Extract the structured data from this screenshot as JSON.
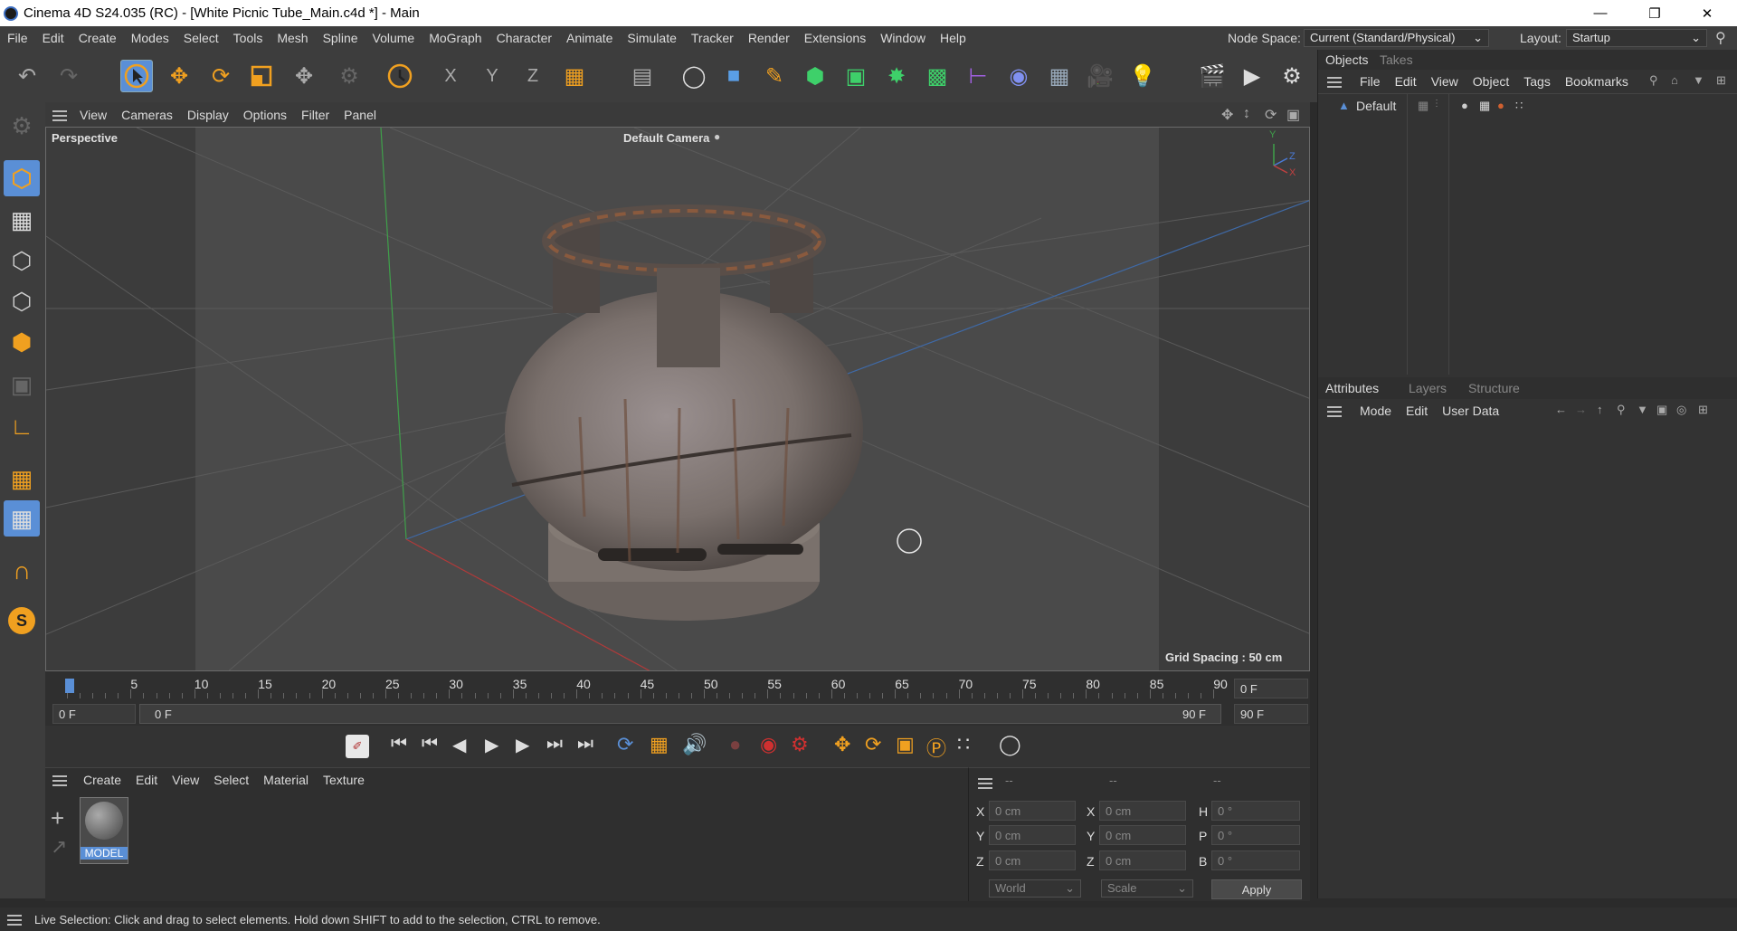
{
  "app": {
    "title": "Cinema 4D S24.035 (RC) - [White Picnic Tube_Main.c4d *] - Main"
  },
  "menubar": {
    "items": [
      "File",
      "Edit",
      "Create",
      "Modes",
      "Select",
      "Tools",
      "Mesh",
      "Spline",
      "Volume",
      "MoGraph",
      "Character",
      "Animate",
      "Simulate",
      "Tracker",
      "Render",
      "Extensions",
      "Window",
      "Help"
    ],
    "node_space_label": "Node Space:",
    "node_space_value": "Current (Standard/Physical)",
    "layout_label": "Layout:",
    "layout_value": "Startup"
  },
  "viewport": {
    "menu": [
      "View",
      "Cameras",
      "Display",
      "Options",
      "Filter",
      "Panel"
    ],
    "view_name": "Perspective",
    "camera": "Default Camera",
    "grid_spacing": "Grid Spacing : 50 cm",
    "axis_labels": {
      "y": "Y",
      "z": "Z",
      "x": "X"
    }
  },
  "timeline": {
    "ticks": [
      "0",
      "5",
      "10",
      "15",
      "20",
      "25",
      "30",
      "35",
      "40",
      "45",
      "50",
      "55",
      "60",
      "65",
      "70",
      "75",
      "80",
      "85",
      "90"
    ],
    "current_frame": "0 F",
    "start_frame": "0 F",
    "range_start": "0 F",
    "range_end": "90 F",
    "end_frame": "90 F"
  },
  "materials": {
    "menu": [
      "Create",
      "Edit",
      "View",
      "Select",
      "Material",
      "Texture"
    ],
    "items": [
      {
        "name": "MODEL"
      }
    ]
  },
  "coords": {
    "headers": [
      "--",
      "--",
      "--"
    ],
    "pos": [
      {
        "axis": "X",
        "value": "0 cm"
      },
      {
        "axis": "Y",
        "value": "0 cm"
      },
      {
        "axis": "Z",
        "value": "0 cm"
      }
    ],
    "size": [
      {
        "axis": "X",
        "value": "0 cm"
      },
      {
        "axis": "Y",
        "value": "0 cm"
      },
      {
        "axis": "Z",
        "value": "0 cm"
      }
    ],
    "rot": [
      {
        "axis": "H",
        "value": "0 °"
      },
      {
        "axis": "P",
        "value": "0 °"
      },
      {
        "axis": "B",
        "value": "0 °"
      }
    ],
    "mode1": "World",
    "mode2": "Scale",
    "apply": "Apply"
  },
  "objects_panel": {
    "tabs": [
      "Objects",
      "Takes"
    ],
    "menu": [
      "File",
      "Edit",
      "View",
      "Object",
      "Tags",
      "Bookmarks"
    ],
    "items": [
      {
        "name": "Default"
      }
    ]
  },
  "attributes_panel": {
    "tabs": [
      "Attributes",
      "Layers",
      "Structure"
    ],
    "menu": [
      "Mode",
      "Edit",
      "User Data"
    ]
  },
  "status": "Live Selection: Click and drag to select elements. Hold down SHIFT to add to the selection, CTRL to remove.",
  "colors": {
    "accent": "#f0a020",
    "blue": "#5a8fd6",
    "orange": "#e8a030"
  }
}
